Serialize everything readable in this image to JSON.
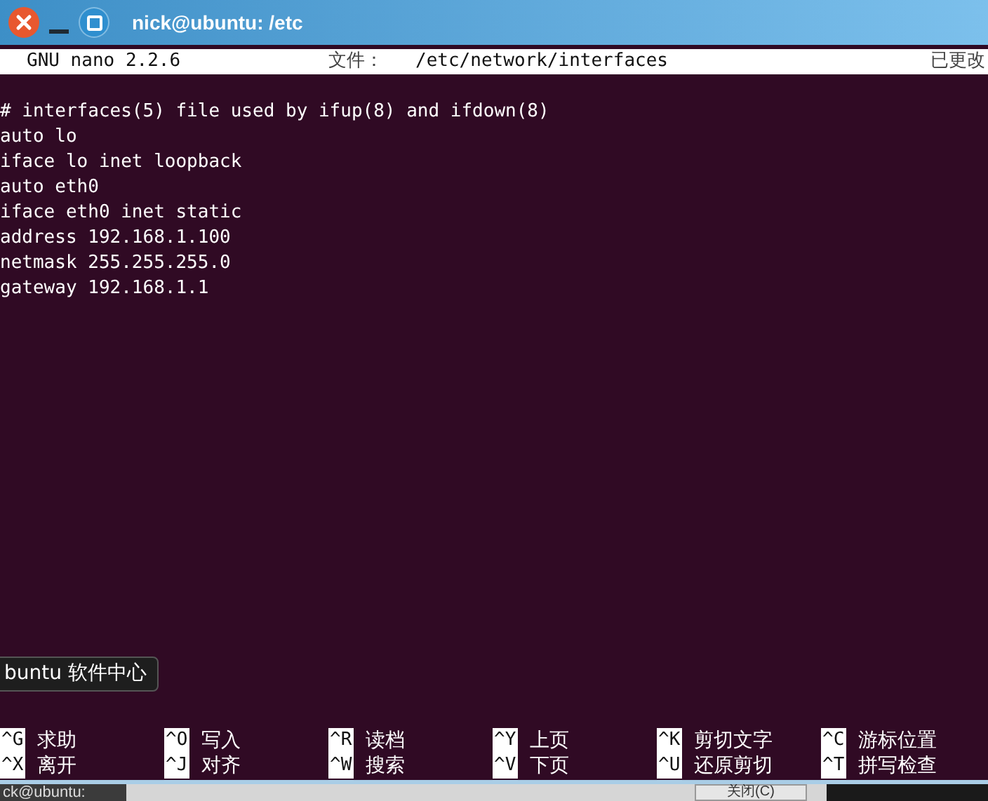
{
  "window": {
    "title": "nick@ubuntu: /etc"
  },
  "header": {
    "app": "GNU nano 2.2.6",
    "file_label": "文件：",
    "file_path": "/etc/network/interfaces",
    "status": "已更改"
  },
  "lines": [
    "# interfaces(5) file used by ifup(8) and ifdown(8)",
    "auto lo",
    "iface lo inet loopback",
    "auto eth0",
    "iface eth0 inet static",
    "address 192.168.1.100",
    "netmask 255.255.255.0",
    "gateway 192.168.1.1"
  ],
  "tooltip": "buntu 软件中心",
  "shortcuts": [
    [
      {
        "key": "^G",
        "label": "求助"
      },
      {
        "key": "^O",
        "label": "写入"
      },
      {
        "key": "^R",
        "label": "读档"
      },
      {
        "key": "^Y",
        "label": "上页"
      },
      {
        "key": "^K",
        "label": "剪切文字"
      },
      {
        "key": "^C",
        "label": "游标位置"
      }
    ],
    [
      {
        "key": "^X",
        "label": "离开"
      },
      {
        "key": "^J",
        "label": "对齐"
      },
      {
        "key": "^W",
        "label": "搜索"
      },
      {
        "key": "^V",
        "label": "下页"
      },
      {
        "key": "^U",
        "label": "还原剪切"
      },
      {
        "key": "^T",
        "label": "拼写检查"
      }
    ]
  ],
  "taskbar": {
    "terminal": "ck@ubuntu:",
    "button": "关闭(C)"
  }
}
